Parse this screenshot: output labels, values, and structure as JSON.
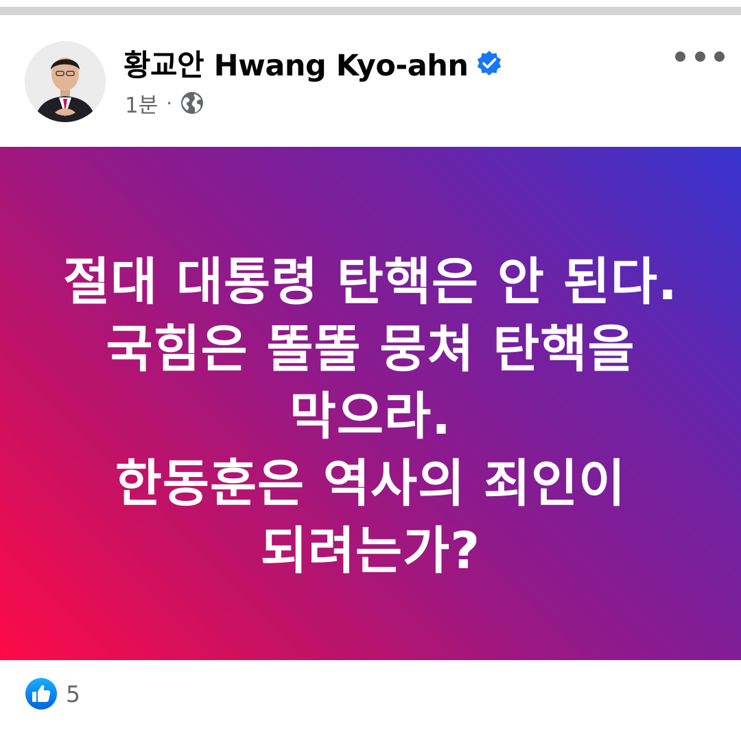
{
  "post": {
    "author": "황교안 Hwang Kyo-ahn",
    "time": "1분",
    "separator": "·",
    "audience_icon": "globe-icon",
    "verified_icon": "verified-badge-icon",
    "more_icon": "more-options-icon",
    "image_text": [
      "절대 대통령 탄핵은 안 된다.",
      "국힘은 똘똘 뭉쳐 탄핵을",
      "막으라.",
      "한동훈은 역사의 죄인이",
      "되려는가?"
    ]
  },
  "reactions": {
    "icon": "like-icon",
    "count": "5"
  },
  "colors": {
    "accent": "#1877f2",
    "gradient_start": "#ff0a47",
    "gradient_end": "#3834cf"
  }
}
